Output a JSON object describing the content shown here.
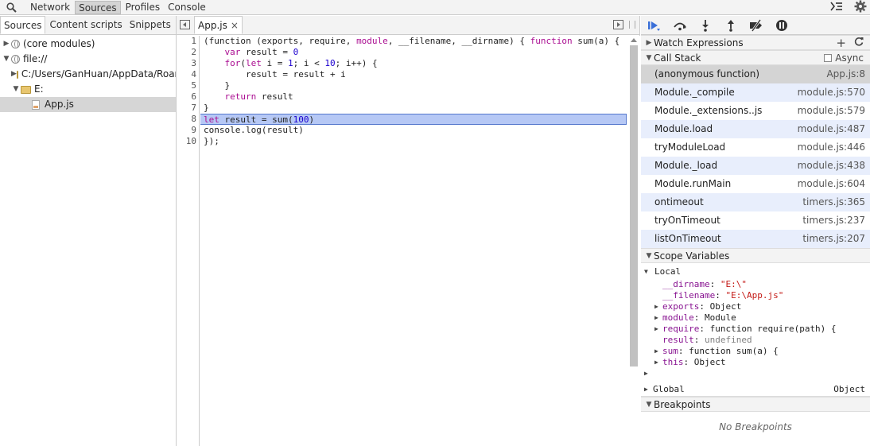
{
  "toolbar": {
    "tabs": [
      {
        "label": "Network"
      },
      {
        "label": "Sources"
      },
      {
        "label": "Profiles"
      },
      {
        "label": "Console"
      }
    ]
  },
  "navigator": {
    "tabs": [
      {
        "label": "Sources"
      },
      {
        "label": "Content scripts"
      },
      {
        "label": "Snippets"
      }
    ],
    "tree": [
      {
        "label": "(core modules)"
      },
      {
        "label": "file://"
      },
      {
        "label": "C:/Users/GanHuan/AppData/Roar"
      },
      {
        "label": "E:"
      },
      {
        "label": "App.js"
      }
    ]
  },
  "editor": {
    "tab_label": "App.js",
    "tab_close": "×",
    "line_numbers": [
      "1",
      "2",
      "3",
      "4",
      "5",
      "6",
      "7",
      "8",
      "9",
      "10"
    ],
    "lines": {
      "l1a": "(function (exports, require, ",
      "l1b": "module",
      "l1c": ", __filename, __dirname) { ",
      "l1d": "function",
      "l1e": " sum(a) {",
      "l2a": "    ",
      "l2b": "var",
      "l2c": " result = ",
      "l2d": "0",
      "l3a": "    ",
      "l3b": "for",
      "l3c": "(",
      "l3d": "let",
      "l3e": " i = ",
      "l3f": "1",
      "l3g": "; i < ",
      "l3h": "10",
      "l3i": "; i++) {",
      "l4": "        result = result + i",
      "l5": "    }",
      "l6a": "    ",
      "l6b": "return",
      "l6c": " result",
      "l7": "}",
      "l8a": "let",
      "l8b": " result = sum(",
      "l8c": "100",
      "l8d": ")",
      "l9": "console.log(result)",
      "l10": "});"
    }
  },
  "debugger": {
    "watch": {
      "title": "Watch Expressions",
      "add": "+",
      "refresh": "C"
    },
    "callstack": {
      "title": "Call Stack",
      "async_label": "Async",
      "frames": [
        {
          "name": "(anonymous function)",
          "location": "App.js:8"
        },
        {
          "name": "Module._compile",
          "location": "module.js:570"
        },
        {
          "name": "Module._extensions..js",
          "location": "module.js:579"
        },
        {
          "name": "Module.load",
          "location": "module.js:487"
        },
        {
          "name": "tryModuleLoad",
          "location": "module.js:446"
        },
        {
          "name": "Module._load",
          "location": "module.js:438"
        },
        {
          "name": "Module.runMain",
          "location": "module.js:604"
        },
        {
          "name": "ontimeout",
          "location": "timers.js:365"
        },
        {
          "name": "tryOnTimeout",
          "location": "timers.js:237"
        },
        {
          "name": "listOnTimeout",
          "location": "timers.js:207"
        }
      ]
    },
    "scope": {
      "title": "Scope Variables",
      "local_label": "Local",
      "vars": [
        {
          "name": "__dirname",
          "sep": ": ",
          "value": "\"E:\\\""
        },
        {
          "name": "__filename",
          "sep": ": ",
          "value": "\"E:\\App.js\""
        },
        {
          "name": "exports",
          "sep": ": ",
          "value": "Object"
        },
        {
          "name": "module",
          "sep": ": ",
          "value": "Module"
        },
        {
          "name": "require",
          "sep": ": ",
          "value": "function require(path) {"
        },
        {
          "name": "result",
          "sep": ": ",
          "value": "undefined"
        },
        {
          "name": "sum",
          "sep": ": ",
          "value": "function sum(a) {"
        },
        {
          "name": "this",
          "sep": ": ",
          "value": "Object"
        }
      ],
      "global_label": "Global",
      "global_value": "Object"
    },
    "breakpoints": {
      "title": "Breakpoints",
      "empty": "No Breakpoints"
    }
  },
  "colors": {
    "accent": "#5577cc",
    "highlight": "#b6c8f5",
    "keyword": "#aa0d91",
    "number": "#1c00cf",
    "string": "#c41a16"
  }
}
